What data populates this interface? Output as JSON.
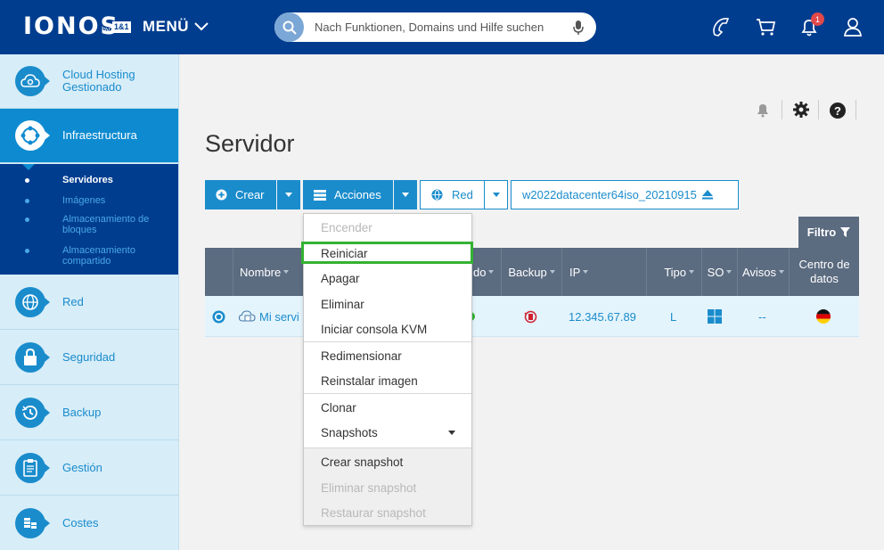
{
  "header": {
    "logo": "IONOS",
    "logo_by": "by",
    "logo_11": "1&1",
    "menu_label": "MENÜ",
    "search_placeholder": "Nach Funktionen, Domains und Hilfe suchen",
    "notification_count": "1"
  },
  "sidebar": {
    "items": [
      {
        "label": "Cloud Hosting Gestionado"
      },
      {
        "label": "Infraestructura"
      },
      {
        "label": "Red"
      },
      {
        "label": "Seguridad"
      },
      {
        "label": "Backup"
      },
      {
        "label": "Gestión"
      },
      {
        "label": "Costes"
      }
    ],
    "subitems": [
      {
        "label": "Servidores"
      },
      {
        "label": "Imágenes"
      },
      {
        "label": "Almacenamiento de bloques"
      },
      {
        "label": "Almacenamiento compartido"
      }
    ]
  },
  "main": {
    "title": "Servidor",
    "toolbar": {
      "crear": "Crear",
      "acciones": "Acciones",
      "red": "Red",
      "iso": "w2022datacenter64iso_20210915"
    },
    "filter_label": "Filtro",
    "table": {
      "headers": {
        "nombre": "Nombre",
        "estado": "do",
        "backup": "Backup",
        "ip": "IP",
        "tipo": "Tipo",
        "so": "SO",
        "avisos": "Avisos",
        "centro": "Centro de datos"
      },
      "row": {
        "nombre": "Mi servi",
        "ip": "12.345.67.89",
        "tipo": "L",
        "avisos": "--"
      }
    }
  },
  "dropdown": {
    "items": [
      {
        "label": "Encender",
        "disabled": true
      },
      {
        "label": "Reiniciar",
        "disabled": false
      },
      {
        "label": "Apagar",
        "disabled": false
      },
      {
        "label": "Eliminar",
        "disabled": false
      },
      {
        "label": "Iniciar consola KVM",
        "disabled": false
      },
      {
        "label": "Redimensionar",
        "disabled": false
      },
      {
        "label": "Reinstalar imagen",
        "disabled": false
      },
      {
        "label": "Clonar",
        "disabled": false
      },
      {
        "label": "Snapshots",
        "disabled": false
      },
      {
        "label": "Crear snapshot",
        "disabled": false
      },
      {
        "label": "Eliminar snapshot",
        "disabled": true
      },
      {
        "label": "Restaurar snapshot",
        "disabled": true
      }
    ]
  },
  "colors": {
    "header_bg": "#003d8f",
    "accent": "#1a8ccc",
    "table_header_bg": "#5b6b80",
    "highlight": "#34b233"
  }
}
